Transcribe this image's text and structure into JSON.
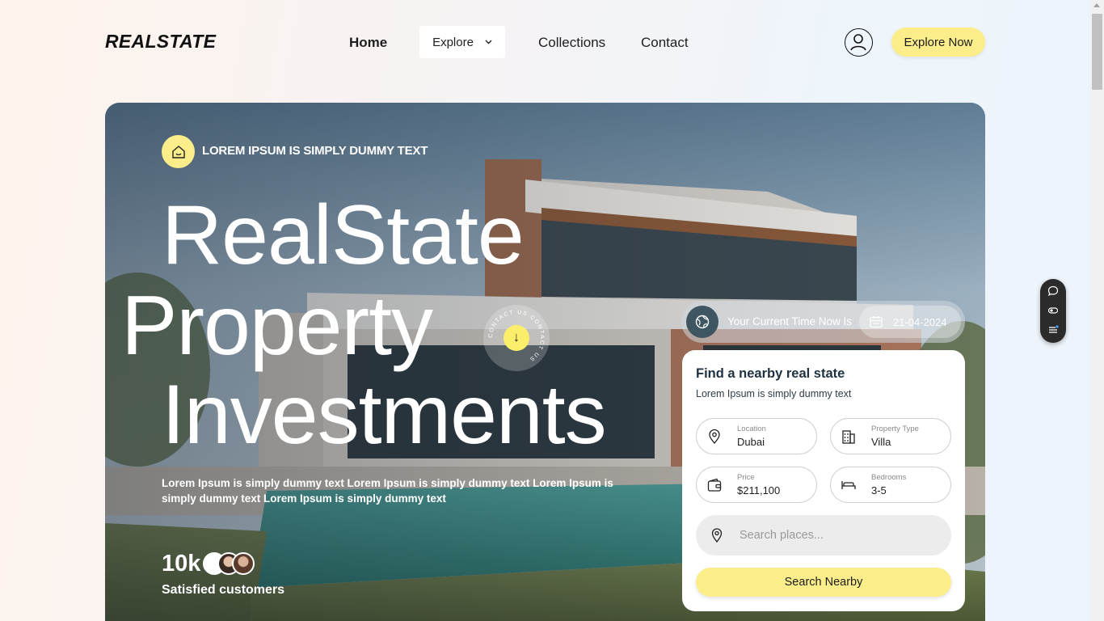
{
  "header": {
    "logo": "REALSTATE",
    "nav": {
      "home": "Home",
      "explore": "Explore",
      "collections": "Collections",
      "contact": "Contact"
    },
    "cta": "Explore Now"
  },
  "hero": {
    "tagline": "LOREM IPSUM IS SIMPLY DUMMY TEXT",
    "title_lines": [
      "RealState",
      "Property",
      "Investments"
    ],
    "badge_text": "CONTACT US CONTACT US",
    "description": "Lorem Ipsum is simply dummy text Lorem Ipsum is simply dummy text Lorem Ipsum is simply dummy text Lorem Ipsum is simply dummy text",
    "stat_number": "10k",
    "stat_label": "Satisfied customers"
  },
  "time_widget": {
    "label": "Your Current Time Now Is",
    "date": "21-04-2024"
  },
  "search_card": {
    "title": "Find a nearby real state",
    "subtitle": "Lorem Ipsum is simply dummy text",
    "fields": {
      "location": {
        "label": "Location",
        "value": "Dubai"
      },
      "property_type": {
        "label": "Property Type",
        "value": "Villa"
      },
      "price": {
        "label": "Price",
        "value": "$211,100"
      },
      "bedrooms": {
        "label": "Bedrooms",
        "value": "3-5"
      }
    },
    "search_placeholder": "Search places...",
    "button": "Search Nearby"
  },
  "colors": {
    "accent": "#fbee8a",
    "card_title": "#1f3140",
    "time_icon_bg": "#3e5562"
  }
}
